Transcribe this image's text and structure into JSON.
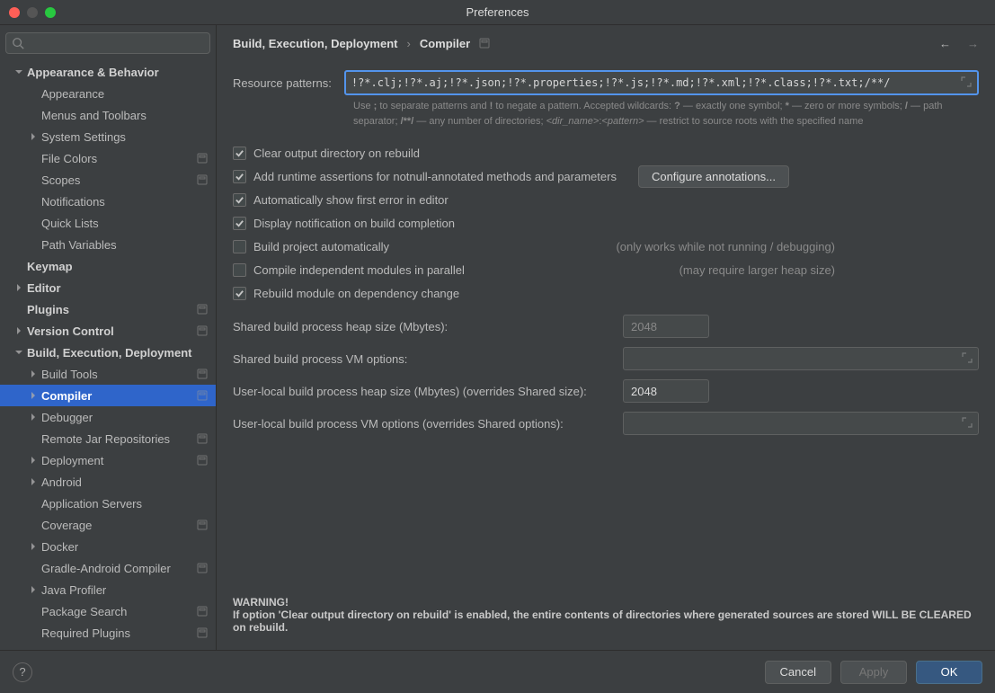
{
  "window_title": "Preferences",
  "search_placeholder": "",
  "breadcrumb": [
    "Build, Execution, Deployment",
    "Compiler"
  ],
  "tree": [
    {
      "label": "Appearance & Behavior",
      "bold": true,
      "chev": "down",
      "indent": 0
    },
    {
      "label": "Appearance",
      "indent": 1
    },
    {
      "label": "Menus and Toolbars",
      "indent": 1
    },
    {
      "label": "System Settings",
      "chev": "right",
      "indent": 1
    },
    {
      "label": "File Colors",
      "indent": 1,
      "proj": true
    },
    {
      "label": "Scopes",
      "indent": 1,
      "proj": true
    },
    {
      "label": "Notifications",
      "indent": 1
    },
    {
      "label": "Quick Lists",
      "indent": 1
    },
    {
      "label": "Path Variables",
      "indent": 1
    },
    {
      "label": "Keymap",
      "bold": true,
      "indent": 0
    },
    {
      "label": "Editor",
      "bold": true,
      "chev": "right",
      "indent": 0
    },
    {
      "label": "Plugins",
      "bold": true,
      "indent": 0,
      "proj": true
    },
    {
      "label": "Version Control",
      "bold": true,
      "chev": "right",
      "indent": 0,
      "proj": true
    },
    {
      "label": "Build, Execution, Deployment",
      "bold": true,
      "chev": "down",
      "indent": 0
    },
    {
      "label": "Build Tools",
      "chev": "right",
      "indent": 1,
      "proj": true
    },
    {
      "label": "Compiler",
      "chev": "right",
      "indent": 1,
      "proj": true,
      "selected": true,
      "bold": true
    },
    {
      "label": "Debugger",
      "chev": "right",
      "indent": 1
    },
    {
      "label": "Remote Jar Repositories",
      "indent": 1,
      "proj": true
    },
    {
      "label": "Deployment",
      "chev": "right",
      "indent": 1,
      "proj": true
    },
    {
      "label": "Android",
      "chev": "right",
      "indent": 1
    },
    {
      "label": "Application Servers",
      "indent": 1
    },
    {
      "label": "Coverage",
      "indent": 1,
      "proj": true
    },
    {
      "label": "Docker",
      "chev": "right",
      "indent": 1
    },
    {
      "label": "Gradle-Android Compiler",
      "indent": 1,
      "proj": true
    },
    {
      "label": "Java Profiler",
      "chev": "right",
      "indent": 1
    },
    {
      "label": "Package Search",
      "indent": 1,
      "proj": true
    },
    {
      "label": "Required Plugins",
      "indent": 1,
      "proj": true
    }
  ],
  "form": {
    "resource_patterns_label": "Resource patterns:",
    "resource_patterns_value": "!?*.clj;!?*.aj;!?*.json;!?*.properties;!?*.js;!?*.md;!?*.xml;!?*.class;!?*.txt;/**/",
    "hint_line1": "Use ; to separate patterns and ! to negate a pattern. Accepted wildcards: ? — exactly one symbol; * — zero or more symbols; / — path separator; /**/ — any number of directories; <dir_name>:<pattern> — restrict to source roots with the specified name",
    "checks": [
      {
        "label": "Clear output directory on rebuild",
        "checked": true
      },
      {
        "label": "Add runtime assertions for notnull-annotated methods and parameters",
        "checked": true,
        "button": "Configure annotations..."
      },
      {
        "label": "Automatically show first error in editor",
        "checked": true
      },
      {
        "label": "Display notification on build completion",
        "checked": true
      },
      {
        "label": "Build project automatically",
        "checked": false,
        "note": "(only works while not running / debugging)"
      },
      {
        "label": "Compile independent modules in parallel",
        "checked": false,
        "note": "(may require larger heap size)"
      },
      {
        "label": "Rebuild module on dependency change",
        "checked": true
      }
    ],
    "rows": [
      {
        "label": "Shared build process heap size (Mbytes):",
        "value": "2048",
        "narrow": true,
        "readonly": true
      },
      {
        "label": "Shared build process VM options:",
        "value": "",
        "expand": true
      },
      {
        "label": "User-local build process heap size (Mbytes) (overrides Shared size):",
        "value": "2048",
        "narrow": true
      },
      {
        "label": "User-local build process VM options (overrides Shared options):",
        "value": "",
        "expand": true
      }
    ],
    "warning_title": "WARNING!",
    "warning_body": "If option 'Clear output directory on rebuild' is enabled, the entire contents of directories where generated sources are stored WILL BE CLEARED on rebuild."
  },
  "footer": {
    "cancel": "Cancel",
    "apply": "Apply",
    "ok": "OK"
  }
}
